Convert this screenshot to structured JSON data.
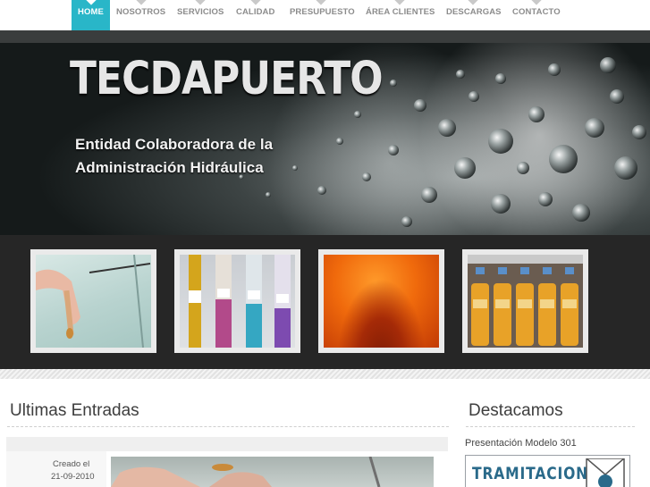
{
  "nav": {
    "items": [
      {
        "label": "HOME",
        "active": true
      },
      {
        "label": "NOSOTROS",
        "active": false
      },
      {
        "label": "SERVICIOS",
        "active": false
      },
      {
        "label": "CALIDAD",
        "active": false
      },
      {
        "label": "PRESUPUESTO",
        "active": false
      },
      {
        "label": "ÁREA CLIENTES",
        "active": false
      },
      {
        "label": "DESCARGAS",
        "active": false
      },
      {
        "label": "CONTACTO",
        "active": false
      }
    ],
    "active_color": "#29b6c8"
  },
  "hero": {
    "title": "TECDAPUERTO",
    "tagline": "Entidad Colaboradora de la Administración Hidráulica"
  },
  "thumbnails": [
    {
      "name": "lab-sample-photo"
    },
    {
      "name": "test-tubes-photo"
    },
    {
      "name": "orange-texture-photo"
    },
    {
      "name": "bottles-photo"
    }
  ],
  "main": {
    "heading": "Ultimas Entradas",
    "post": {
      "created_label": "Creado el",
      "date": "21-09-2010"
    }
  },
  "sidebar": {
    "heading": "Destacamos",
    "link": "Presentación Modelo 301",
    "banner_text": "TRAMITACION"
  }
}
